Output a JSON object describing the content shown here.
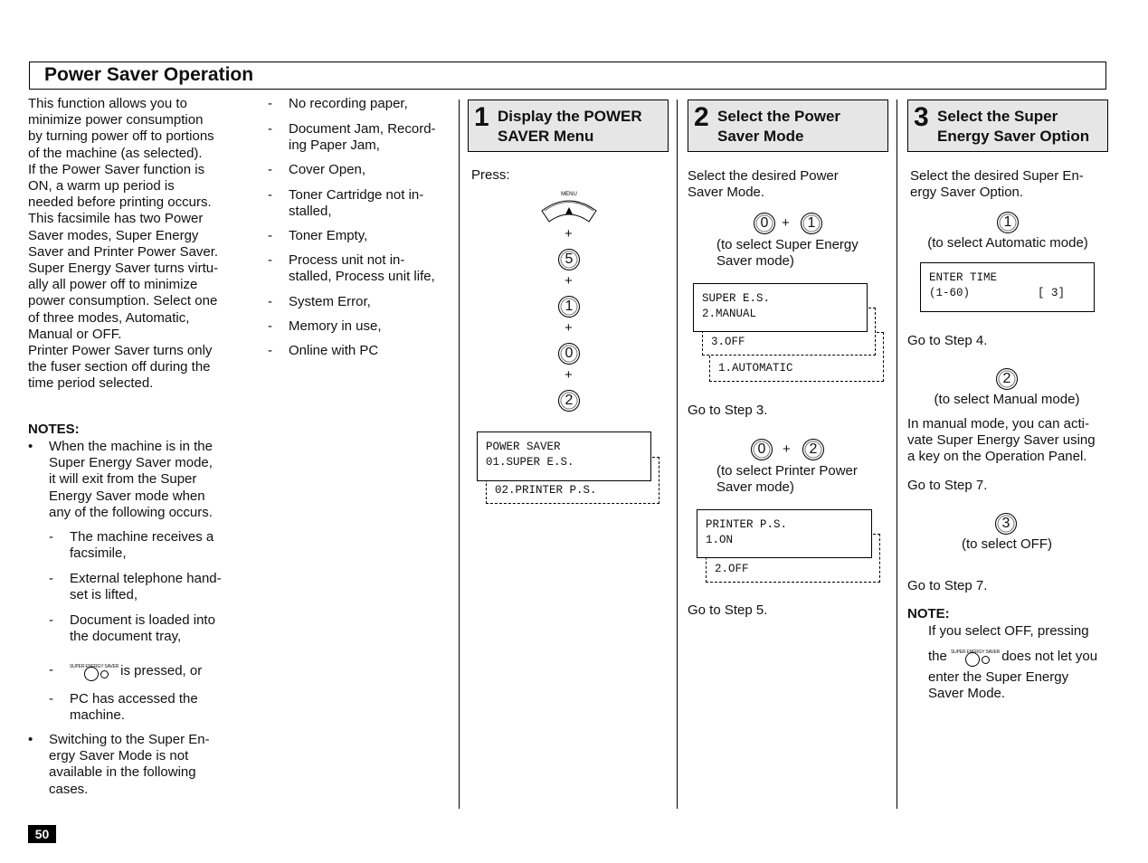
{
  "title": "Power Saver Operation",
  "page_number": "50",
  "intro": [
    "This function allows you to",
    "minimize power consumption",
    "by turning power off to portions",
    "of the machine (as selected).",
    "If the Power Saver function is",
    "ON, a warm up period is",
    "needed before printing occurs.",
    "This facsimile has two Power",
    "Saver modes, Super Energy",
    "Saver and Printer Power Saver.",
    "Super Energy Saver turns virtu-",
    "ally all power off to minimize",
    "power consumption. Select one",
    "of three modes, Automatic,",
    "Manual or OFF.",
    "Printer Power Saver turns only",
    "the fuser section off during the",
    "time period selected."
  ],
  "notes": {
    "heading": "NOTES:",
    "bullet1": [
      "When the machine is in the",
      "Super Energy Saver mode,",
      "it will exit from the Super",
      "Energy Saver mode when",
      "any of the following occurs."
    ],
    "sub_items": [
      [
        "The machine receives a",
        "facsimile,"
      ],
      [
        "External telephone hand-",
        "set is lifted,"
      ],
      [
        "Document is loaded into",
        "the document tray,"
      ],
      [
        "is pressed, or"
      ],
      [
        "PC has accessed the",
        "machine."
      ]
    ],
    "super_energy_saver_label": "SUPER ENERGY SAVER",
    "bullet2": [
      "Switching to the Super En-",
      "ergy Saver Mode is not",
      "available in the following",
      "cases."
    ],
    "cases": [
      [
        "No recording paper,"
      ],
      [
        "Document Jam, Record-",
        "ing Paper Jam,"
      ],
      [
        "Cover Open,"
      ],
      [
        "Toner Cartridge not in-",
        "stalled,"
      ],
      [
        "Toner Empty,"
      ],
      [
        "Process unit not in-",
        "stalled, Process unit life,"
      ],
      [
        "System Error,"
      ],
      [
        "Memory in use,"
      ],
      [
        "Online with PC"
      ]
    ]
  },
  "steps": [
    {
      "number": "1",
      "label": "Display the POWER\nSAVER Menu",
      "press": "Press:",
      "menu_label": "MENU",
      "keys": [
        "5",
        "1",
        "0",
        "2"
      ],
      "plus": "+",
      "lcd": "POWER SAVER\n01.SUPER E.S.",
      "lcd_next": "02.PRINTER P.S."
    },
    {
      "number": "2",
      "label": "Select the Power\nSaver Mode",
      "intro": [
        "Select the desired Power",
        "Saver Mode."
      ],
      "opt1": {
        "keys": [
          "0",
          "1"
        ],
        "text": [
          "(to select Super Energy",
          "Saver mode)"
        ],
        "lcd": "SUPER E.S.\n2.MANUAL",
        "lcd_next": [
          "3.OFF",
          "1.AUTOMATIC"
        ],
        "go": "Go to Step 3."
      },
      "opt2": {
        "keys": [
          "0",
          "2"
        ],
        "text": [
          "(to select Printer Power",
          "Saver mode)"
        ],
        "lcd": "PRINTER P.S.\n1.ON",
        "lcd_next": "2.OFF",
        "go": "Go to Step 5."
      }
    },
    {
      "number": "3",
      "label": "Select the Super\nEnergy Saver Option",
      "intro": [
        "Select the desired Super En-",
        "ergy Saver Option."
      ],
      "opt1": {
        "key": "1",
        "text": "(to select Automatic mode)",
        "lcd": "ENTER TIME\n(1-60)          [ 3]",
        "go": "Go to Step 4."
      },
      "opt2": {
        "key": "2",
        "text": "(to select Manual mode)",
        "desc": [
          "In manual mode, you can acti-",
          "vate Super Energy Saver using",
          "a key on the Operation Panel."
        ],
        "go": "Go to Step 7."
      },
      "opt3": {
        "key": "3",
        "text": "(to select OFF)",
        "go": "Go to Step 7."
      },
      "note": {
        "heading": "NOTE:",
        "lines": [
          "If you select OFF, pressing",
          "the",
          "does not let you",
          "enter the Super Energy",
          "Saver Mode."
        ]
      }
    }
  ]
}
